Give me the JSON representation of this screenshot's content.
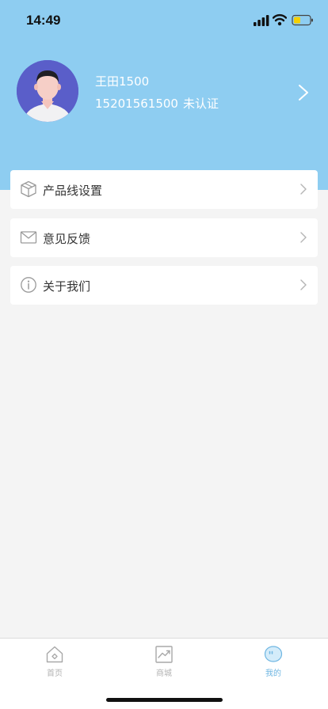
{
  "status_bar": {
    "time": "14:49",
    "icons": [
      "signal-icon",
      "wifi-icon",
      "battery-icon"
    ]
  },
  "profile": {
    "name": "王田1500",
    "phone": "15201561500",
    "verification": "未认证",
    "arrow_icon": "chevron-right-icon"
  },
  "menu": [
    {
      "label": "产品线设置",
      "icon": "cube-icon"
    },
    {
      "label": "意见反馈",
      "icon": "envelope-icon"
    },
    {
      "label": "关于我们",
      "icon": "info-icon"
    }
  ],
  "tabbar": {
    "items": [
      {
        "label": "首页",
        "icon": "home-icon",
        "active": false
      },
      {
        "label": "商城",
        "icon": "trend-chart-icon",
        "active": false
      },
      {
        "label": "我的",
        "icon": "chat-bubble-icon",
        "active": true
      }
    ]
  },
  "colors": {
    "header_bg": "#8ecdf1",
    "page_bg": "#f4f4f4",
    "tab_active": "#6fb6e2",
    "tab_inactive": "#b3b3b3"
  }
}
